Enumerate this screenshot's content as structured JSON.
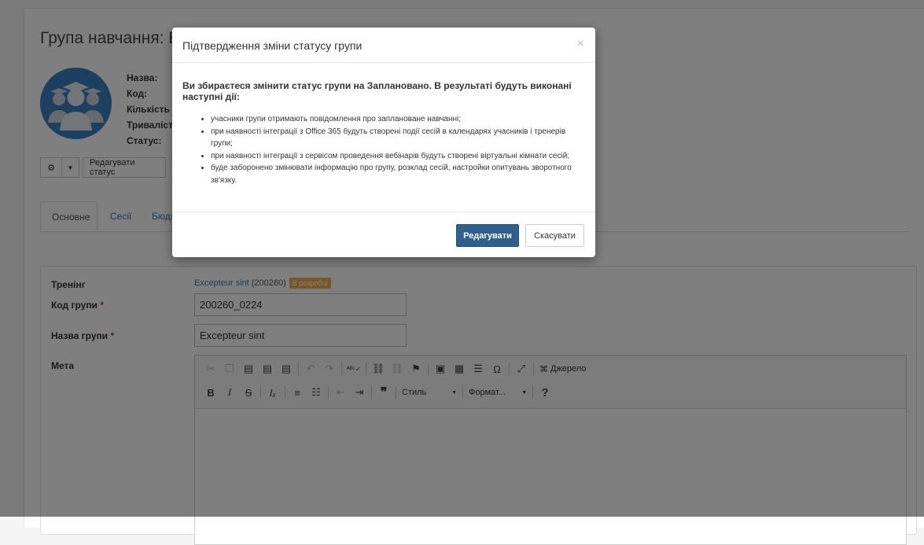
{
  "page": {
    "title": "Група навчання: E",
    "info_labels": [
      "Назва:",
      "Код:",
      "Кількість с",
      "Тривалість:",
      "Статус:"
    ],
    "toolbar": {
      "edit_status_label": "Редагувати статус"
    },
    "tabs": [
      "Основне",
      "Сесії",
      "Бюдж"
    ]
  },
  "form": {
    "training_label": "Тренінг",
    "training_link": "Excepteur sint",
    "training_code": "(200260)",
    "training_badge": "В розробці",
    "group_code_label": "Код групи",
    "group_code_value": "200260_0224",
    "group_name_label": "Назва групи",
    "group_name_value": "Excepteur sint",
    "meta_label": "Мета",
    "required_mark": "*"
  },
  "editor": {
    "source_label": "Джерело",
    "style_combo": "Стиль",
    "format_combo": "Формат...",
    "help": "?"
  },
  "modal": {
    "title": "Підтвердження зміни статусу групи",
    "close": "×",
    "lead": "Ви збираєтеся змінити статус групи на Заплановано. В результаті будуть виконані наступні дії:",
    "items": [
      "учасники групи отримають повідомлення про заплановане навчанні;",
      "при наявності інтеграції з Office 365 будуть створені події сесій в календарях учасників і тренерів групи;",
      "при наявності інтеграції з сервісом проведення вебінарів будуть створені віртуальні кімнати сесій;",
      "буде заборонено змінювати інформацію про групу, розклад сесій, настройки опитувань зворотного зв'язку."
    ],
    "confirm_label": "Редагувати",
    "cancel_label": "Скасувати"
  },
  "colors": {
    "primary": "#2f5f8f",
    "avatar": "#3a7fc0",
    "badge": "#f0ad4e",
    "link": "#337ab7"
  }
}
